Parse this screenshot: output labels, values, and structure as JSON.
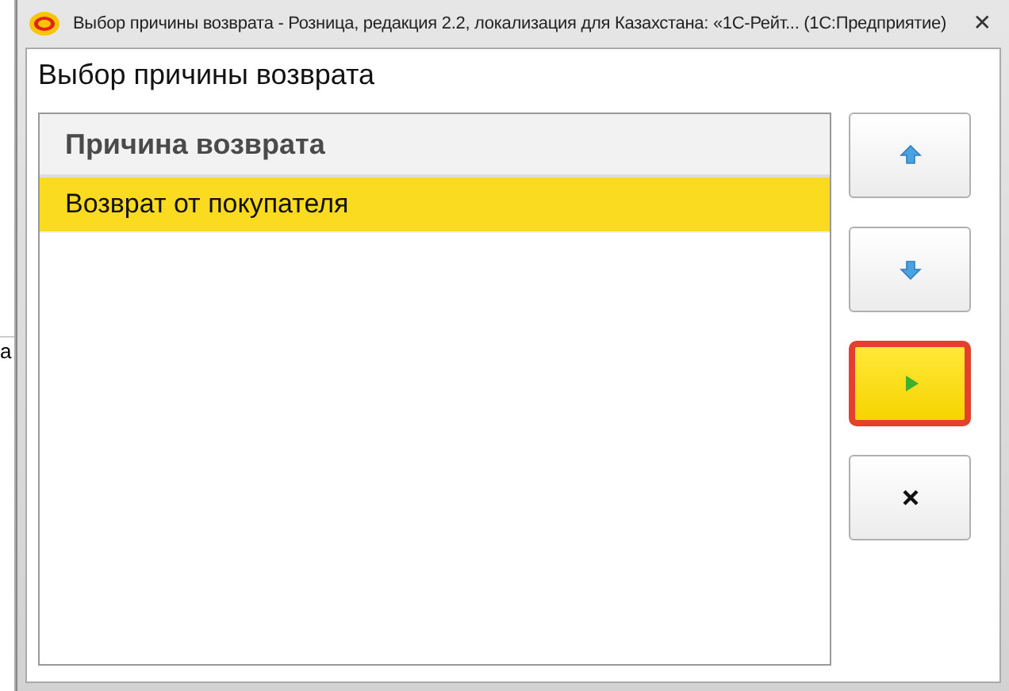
{
  "background_fragment": "а",
  "window": {
    "title": "Выбор причины возврата - Розница, редакция 2.2, локализация для Казахстана: «1С-Рейт...  (1С:Предприятие)",
    "close": "✕"
  },
  "form": {
    "heading": "Выбор причины возврата"
  },
  "table": {
    "columns": [
      "Причина возврата"
    ],
    "rows": [
      {
        "cells": [
          "Возврат от покупателя"
        ],
        "selected": true
      }
    ]
  },
  "buttons": [
    {
      "kind": "up",
      "default": false
    },
    {
      "kind": "down",
      "default": false
    },
    {
      "kind": "choose",
      "default": true
    },
    {
      "kind": "close",
      "default": false
    }
  ]
}
